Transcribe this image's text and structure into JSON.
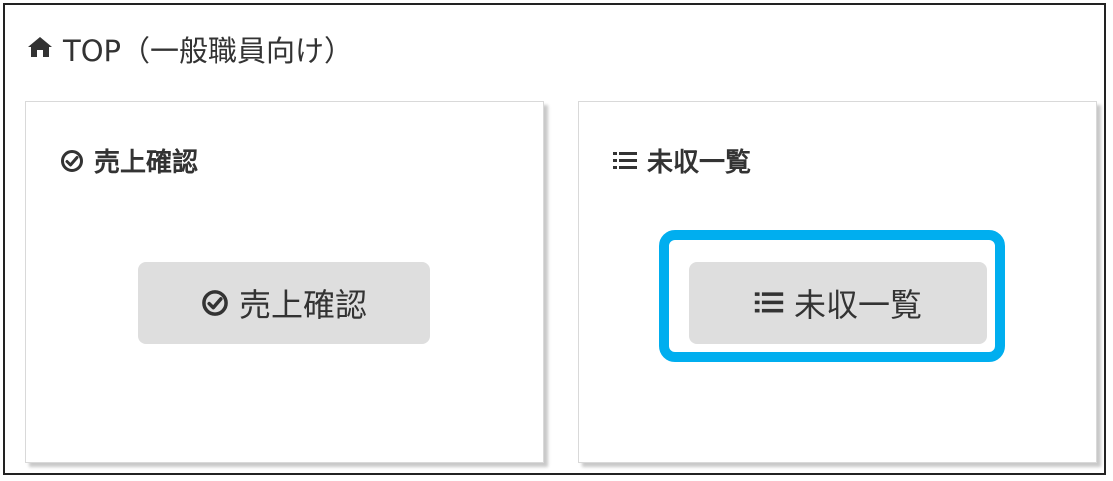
{
  "page": {
    "title": "TOP（一般職員向け）",
    "title_icon": "home-icon"
  },
  "cards": {
    "sales": {
      "header": "売上確認",
      "header_icon": "check-circle-icon",
      "button_label": "売上確認",
      "button_icon": "check-circle-icon"
    },
    "unpaid": {
      "header": "未収一覧",
      "header_icon": "list-icon",
      "button_label": "未収一覧",
      "button_icon": "list-icon"
    }
  },
  "colors": {
    "highlight": "#00aeef",
    "button_bg": "#dedede",
    "text": "#333333"
  }
}
